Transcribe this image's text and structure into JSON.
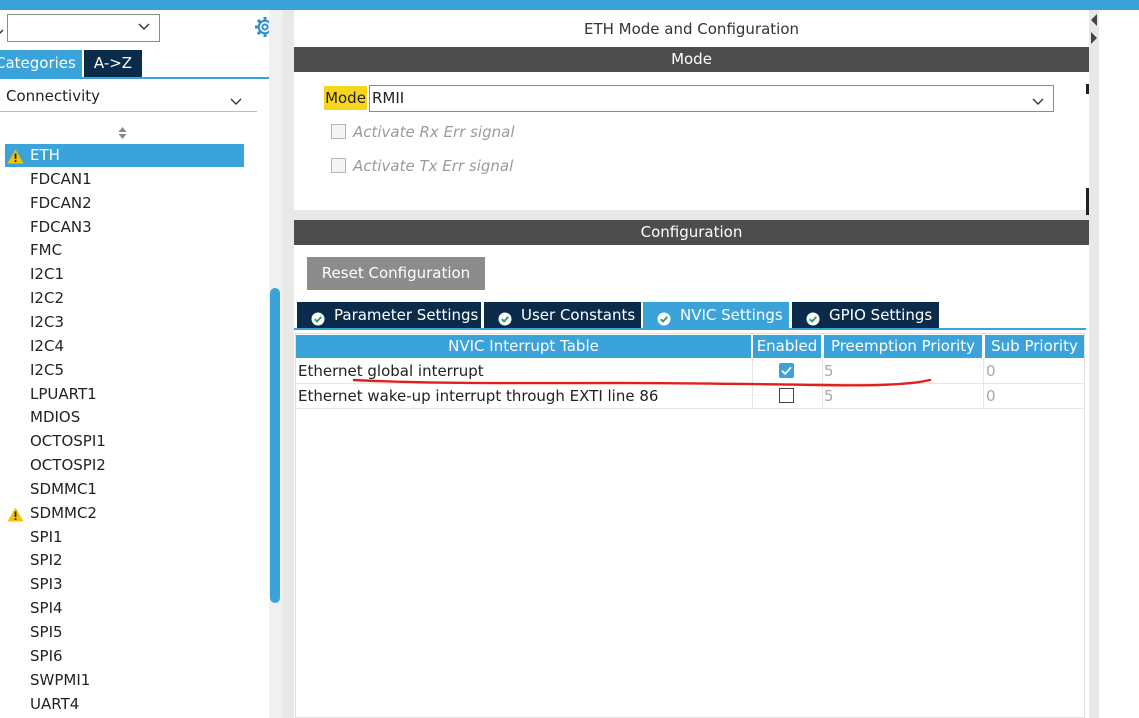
{
  "sidebar": {
    "search": {
      "value": "",
      "placeholder": ""
    },
    "tabs": {
      "categories": "Categories",
      "az": "A->Z"
    },
    "category": "Connectivity",
    "items": [
      {
        "label": "ETH",
        "warning": true,
        "selected": true
      },
      {
        "label": "FDCAN1",
        "warning": false
      },
      {
        "label": "FDCAN2",
        "warning": false
      },
      {
        "label": "FDCAN3",
        "warning": false
      },
      {
        "label": "FMC",
        "warning": false
      },
      {
        "label": "I2C1",
        "warning": false
      },
      {
        "label": "I2C2",
        "warning": false
      },
      {
        "label": "I2C3",
        "warning": false
      },
      {
        "label": "I2C4",
        "warning": false
      },
      {
        "label": "I2C5",
        "warning": false
      },
      {
        "label": "LPUART1",
        "warning": false
      },
      {
        "label": "MDIOS",
        "warning": false
      },
      {
        "label": "OCTOSPI1",
        "warning": false
      },
      {
        "label": "OCTOSPI2",
        "warning": false
      },
      {
        "label": "SDMMC1",
        "warning": false
      },
      {
        "label": "SDMMC2",
        "warning": true
      },
      {
        "label": "SPI1",
        "warning": false
      },
      {
        "label": "SPI2",
        "warning": false
      },
      {
        "label": "SPI3",
        "warning": false
      },
      {
        "label": "SPI4",
        "warning": false
      },
      {
        "label": "SPI5",
        "warning": false
      },
      {
        "label": "SPI6",
        "warning": false
      },
      {
        "label": "SWPMI1",
        "warning": false
      },
      {
        "label": "UART4",
        "warning": false
      }
    ]
  },
  "main": {
    "title": "ETH Mode and Configuration",
    "mode_section": "Mode",
    "mode_label": "Mode",
    "mode_value": "RMII",
    "checkboxes": [
      {
        "label": "Activate Rx Err signal",
        "checked": false,
        "enabled": false
      },
      {
        "label": "Activate Tx Err signal",
        "checked": false,
        "enabled": false
      }
    ],
    "config_section": "Configuration",
    "reset_button": "Reset Configuration",
    "tabs": [
      {
        "label": "Parameter Settings",
        "active": false
      },
      {
        "label": "User Constants",
        "active": false
      },
      {
        "label": "NVIC Settings",
        "active": true
      },
      {
        "label": "GPIO Settings",
        "active": false
      }
    ],
    "nvic_table": {
      "headers": [
        "NVIC Interrupt Table",
        "Enabled",
        "Preemption Priority",
        "Sub Priority"
      ],
      "rows": [
        {
          "name": "Ethernet global interrupt",
          "enabled": true,
          "preemption": "5",
          "sub": "0"
        },
        {
          "name": "Ethernet wake-up interrupt through EXTI line 86",
          "enabled": false,
          "preemption": "5",
          "sub": "0"
        }
      ]
    }
  },
  "colors": {
    "accent": "#3aa3d9",
    "navy": "#0b2b4a",
    "section_bar": "#4d4d4d",
    "warning": "#f5c400",
    "mode_highlight": "#f7d51d",
    "annotation": "#e0201c"
  },
  "icons": {
    "gear": "gear-icon",
    "warning": "warning-icon",
    "chevron": "chevron-down-icon",
    "sort": "sort-icon",
    "tab_check": "check-circle-icon"
  }
}
